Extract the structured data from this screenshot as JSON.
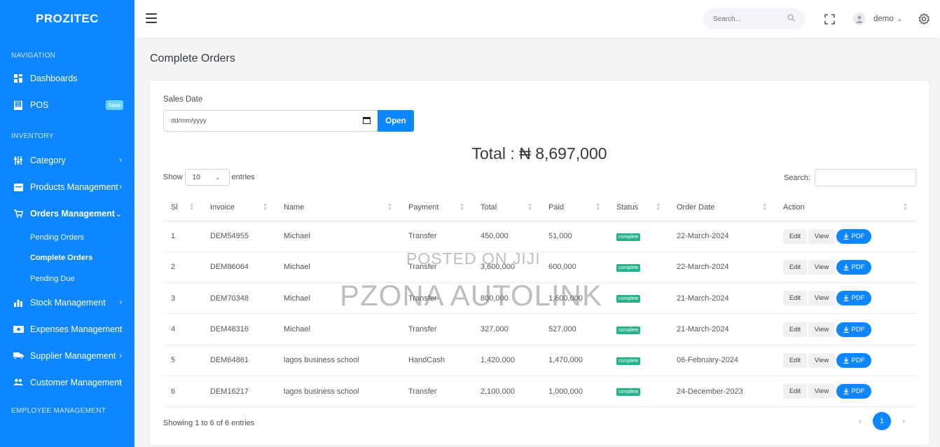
{
  "brand": "PROZITEC",
  "nav": {
    "section_navigation": "NAVIGATION",
    "dashboards": "Dashboards",
    "pos": "POS",
    "pos_badge": "New",
    "section_inventory": "INVENTORY",
    "category": "Category",
    "products": "Products Management",
    "orders": "Orders Management",
    "sub_pending": "Pending Orders",
    "sub_complete": "Complete Orders",
    "sub_due": "Pending Due",
    "stock": "Stock Management",
    "expenses": "Expenses Management",
    "supplier": "Supplier Management",
    "customer": "Customer Management",
    "section_employee": "EMPLOYEE MANAGEMENT"
  },
  "topbar": {
    "search_placeholder": "Search...",
    "user_name": "demo"
  },
  "page": {
    "title": "Complete Orders",
    "sales_date_label": "Sales Date",
    "date_placeholder": "dd/mm/yyyy",
    "open_button": "Open",
    "total_text": "Total : ₦ 8,697,000",
    "show_label": "Show",
    "show_value": "10",
    "entries_label": "entries",
    "search_label": "Search:",
    "showing_text": "Showing 1 to 6 of 6 entries",
    "current_page": "1"
  },
  "table": {
    "headers": [
      "Sl",
      "Invoice",
      "Name",
      "Payment",
      "Total",
      "Paid",
      "Status",
      "Order Date",
      "Action"
    ],
    "rows": [
      [
        "1",
        "DEM54955",
        "Michael",
        "Transfer",
        "450,000",
        "51,000",
        "complete",
        "22-March-2024"
      ],
      [
        "2",
        "DEM86064",
        "Michael",
        "Transfer",
        "3,600,000",
        "600,000",
        "complete",
        "22-March-2024"
      ],
      [
        "3",
        "DEM70348",
        "Michael",
        "Transfer",
        "800,000",
        "1,600,000",
        "complete",
        "21-March-2024"
      ],
      [
        "4",
        "DEM48316",
        "Michael",
        "Transfer",
        "327,000",
        "527,000",
        "complete",
        "21-March-2024"
      ],
      [
        "5",
        "DEM64861",
        "lagos business school",
        "HandCash",
        "1,420,000",
        "1,470,000",
        "complete",
        "06-February-2024"
      ],
      [
        "6",
        "DEM16217",
        "lagos business school",
        "Transfer",
        "2,100,000",
        "1,000,000",
        "complete",
        "24-December-2023"
      ]
    ],
    "edit_label": "Edit",
    "view_label": "View",
    "pdf_label": "PDF"
  },
  "watermark": {
    "line1": "POSTED ON JIJI",
    "line2": "PZONA AUTOLINK"
  },
  "colors": {
    "primary": "#0d86ff",
    "status_complete": "#22b38a",
    "background": "#f3f3f4"
  },
  "icons": [
    "dashboard-icon",
    "pos-icon",
    "category-icon",
    "products-icon",
    "cart-icon",
    "stock-icon",
    "expenses-icon",
    "truck-icon",
    "customers-icon",
    "menu-icon",
    "search-icon",
    "fullscreen-icon",
    "gear-icon",
    "download-icon",
    "calendar-icon"
  ]
}
